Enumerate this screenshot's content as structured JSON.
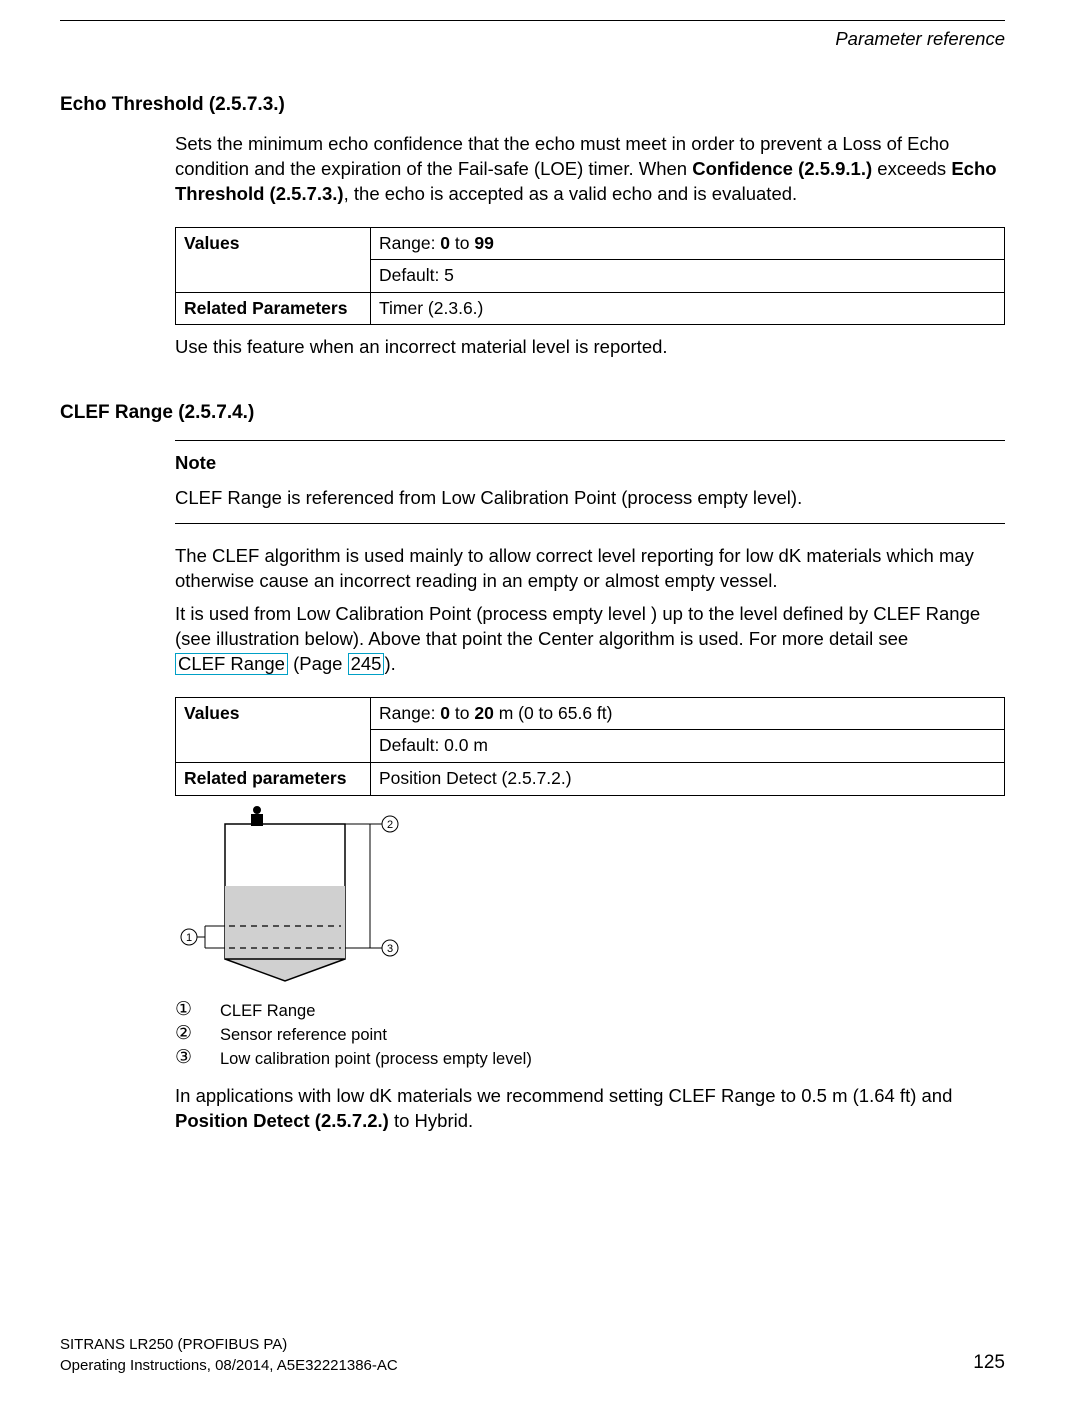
{
  "header": {
    "section": "Parameter reference"
  },
  "s1": {
    "title": "Echo Threshold (2.5.7.3.)",
    "p1a": "Sets the minimum echo confidence that the echo must meet in order to prevent a Loss of Echo condition and the expiration of the Fail-safe (LOE) timer. When ",
    "p1b": "Confidence (2.5.9.1.)",
    "p1c": " exceeds ",
    "p1d": "Echo Threshold (2.5.7.3.)",
    "p1e": ", the echo is accepted as a valid echo and is evaluated.",
    "table": {
      "valuesLabel": "Values",
      "rangeA": "Range: ",
      "rangeB": "0",
      "rangeC": " to ",
      "rangeD": "99",
      "default": "Default: 5",
      "relLabel": "Related Parameters",
      "relVal": "Timer (2.3.6.)"
    },
    "p2": "Use this feature when an incorrect material level is reported."
  },
  "s2": {
    "title": "CLEF Range (2.5.7.4.)",
    "noteTitle": "Note",
    "noteBody": "CLEF Range is referenced from Low Calibration Point (process empty level).",
    "p1": "The CLEF algorithm is used mainly to allow correct level reporting for low dK materials which may otherwise cause an incorrect reading in an empty or almost empty vessel.",
    "p2a": "It is used from Low Calibration Point (process empty level ) up to the level defined by CLEF Range (see illustration below). Above that point the Center algorithm is used. For more detail see ",
    "linkA": "CLEF Range",
    "linkMid": " (Page ",
    "linkB": "245",
    "linkEnd": ").",
    "table": {
      "valuesLabel": "Values",
      "rangeA": "Range: ",
      "rangeB": "0",
      "rangeC": " to ",
      "rangeD": "20",
      "rangeE": " m (0 to 65.6 ft)",
      "default": "Default: 0.0 m",
      "relLabel": "Related parameters",
      "relVal": "Position Detect (2.5.7.2.)"
    },
    "legend": {
      "n1": "①",
      "t1": "CLEF Range",
      "n2": "②",
      "t2": "Sensor reference point",
      "n3": "③",
      "t3": "Low calibration point (process empty level)"
    },
    "p3a": "In applications with low dK materials we recommend setting CLEF Range to 0.5 m (1.64 ft) and ",
    "p3b": "Position Detect (2.5.7.2.)",
    "p3c": " to Hybrid."
  },
  "footer": {
    "line1": "SITRANS LR250 (PROFIBUS PA)",
    "line2": "Operating Instructions, 08/2014, A5E32221386-AC",
    "page": "125"
  }
}
